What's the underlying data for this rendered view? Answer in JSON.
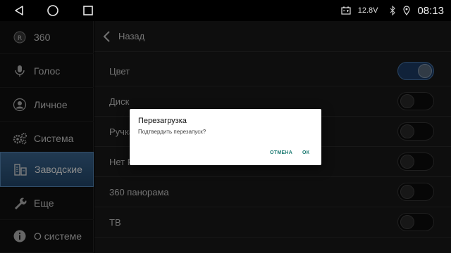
{
  "statusbar": {
    "voltage": "12.8V",
    "time": "08:13"
  },
  "sidebar": {
    "items": [
      {
        "label": "360",
        "icon": "r-badge-icon"
      },
      {
        "label": "Голос",
        "icon": "microphone-icon"
      },
      {
        "label": "Личное",
        "icon": "person-icon"
      },
      {
        "label": "Система",
        "icon": "gears-icon"
      },
      {
        "label": "Заводские",
        "icon": "factory-icon",
        "active": true
      },
      {
        "label": "Еще",
        "icon": "wrench-icon"
      },
      {
        "label": "О системе",
        "icon": "info-icon"
      }
    ]
  },
  "main": {
    "back_label": "Назад",
    "rows": [
      {
        "label": "Цвет",
        "on": true
      },
      {
        "label": "Диск",
        "on": false
      },
      {
        "label": "Ручка",
        "on": false
      },
      {
        "label": "Нет F",
        "on": false
      },
      {
        "label": "360 панорама",
        "on": false
      },
      {
        "label": "ТВ",
        "on": false
      }
    ]
  },
  "dialog": {
    "title": "Перезагрузка",
    "message": "Подтвердить перезапуск?",
    "cancel_label": "ОТМЕНА",
    "ok_label": "ОК"
  },
  "colors": {
    "active_item": "#2f5b86",
    "dialog_button": "#1c7a72"
  }
}
